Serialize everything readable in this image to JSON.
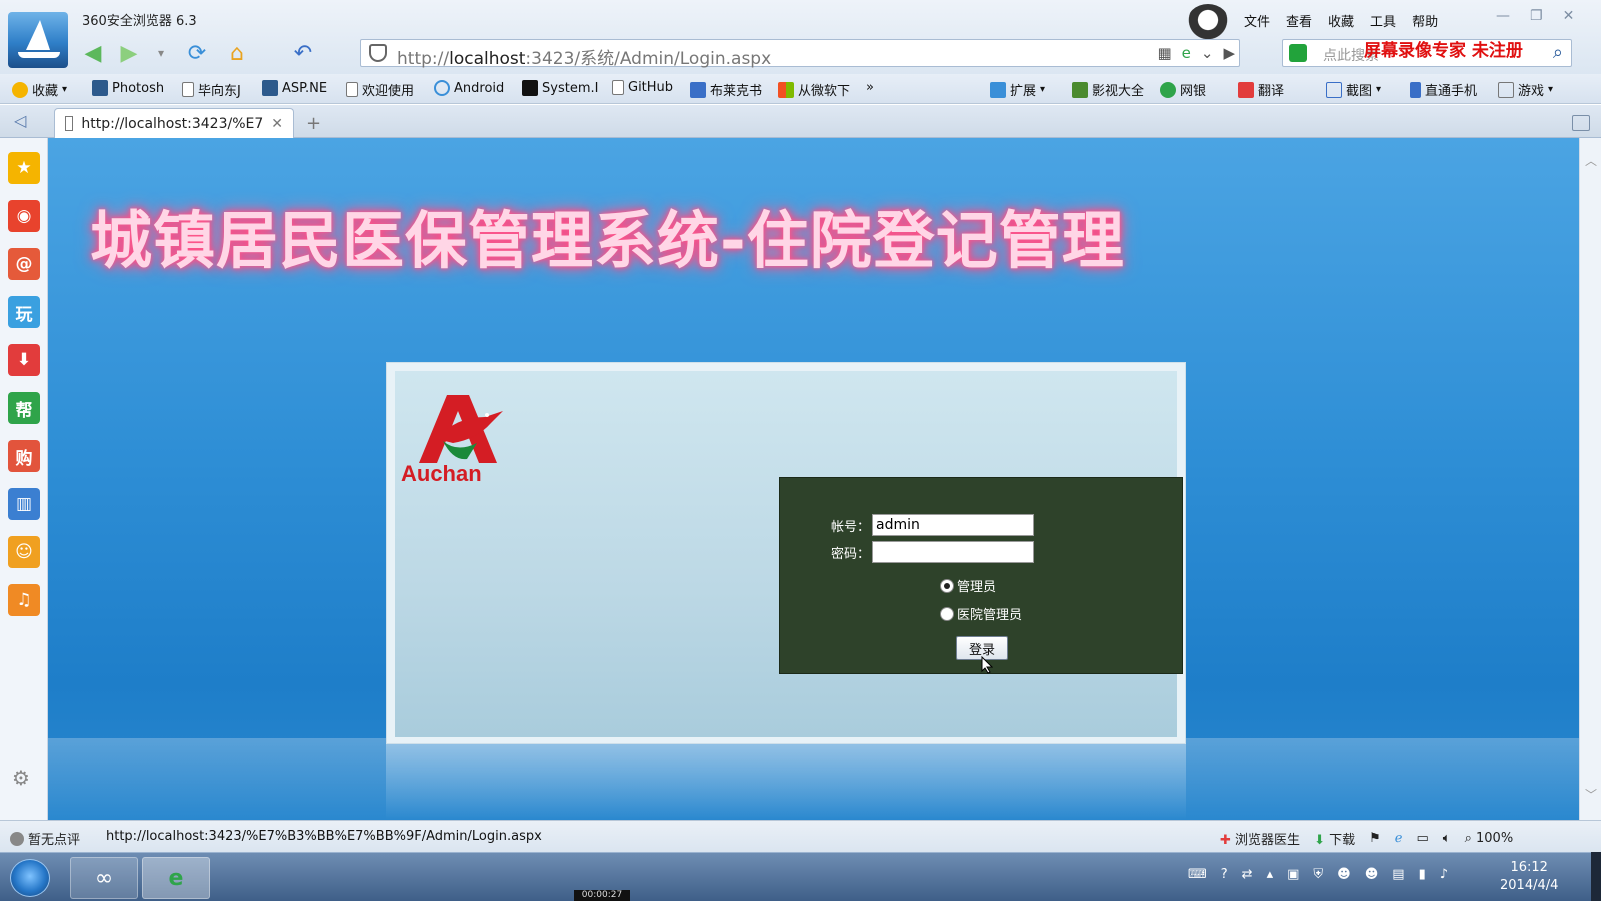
{
  "window": {
    "title": "360安全浏览器 6.3",
    "menu": [
      "文件",
      "查看",
      "收藏",
      "工具",
      "帮助"
    ],
    "watermark": "屏幕录像专家  未注册"
  },
  "nav": {
    "url_prefix": "http://",
    "url_host": "localhost",
    "url_rest": ":3423/系统/Admin/Login.aspx",
    "search_placeholder": "点此搜索"
  },
  "bookmarks": {
    "left": [
      {
        "label": "收藏",
        "icon": "star-icon"
      },
      {
        "label": "Photosh",
        "icon": "v-icon"
      },
      {
        "label": "毕向东J",
        "icon": "page-icon"
      },
      {
        "label": "ASP.NE",
        "icon": "v-icon"
      },
      {
        "label": "欢迎使用",
        "icon": "page-icon"
      },
      {
        "label": "Android",
        "icon": "play-icon"
      },
      {
        "label": "System.I",
        "icon": "m-icon"
      },
      {
        "label": "GitHub",
        "icon": "page-icon"
      },
      {
        "label": "布莱克书",
        "icon": "paw-icon"
      },
      {
        "label": "从微软下",
        "icon": "windows-icon"
      }
    ],
    "more": "»",
    "right": [
      {
        "label": "扩展",
        "icon": "puzzle-icon"
      },
      {
        "label": "影视大全",
        "icon": "video-icon"
      },
      {
        "label": "网银",
        "icon": "bank-icon"
      },
      {
        "label": "翻译",
        "icon": "translate-icon"
      },
      {
        "label": "截图",
        "icon": "screenshot-icon"
      },
      {
        "label": "直通手机",
        "icon": "phone-icon"
      },
      {
        "label": "游戏",
        "icon": "game-icon"
      }
    ]
  },
  "tab": {
    "title": "http://localhost:3423/%E7",
    "close": "✕",
    "new": "+"
  },
  "sidebar": {
    "items": [
      {
        "icon": "favorites-star-icon",
        "glyph": "★",
        "color": "#f5b400"
      },
      {
        "icon": "weibo-icon",
        "glyph": "◉",
        "color": "#e8432d"
      },
      {
        "icon": "mail-icon",
        "glyph": "@",
        "color": "#e55a3a"
      },
      {
        "icon": "play-icon",
        "glyph": "玩",
        "color": "#3aa0e0"
      },
      {
        "icon": "download-icon",
        "glyph": "⬇",
        "color": "#e23c3c"
      },
      {
        "icon": "help-icon",
        "glyph": "帮",
        "color": "#2fa44a"
      },
      {
        "icon": "shopping-icon",
        "glyph": "购",
        "color": "#e2543c"
      },
      {
        "icon": "reading-icon",
        "glyph": "▥",
        "color": "#3b7fd1"
      },
      {
        "icon": "joke-icon",
        "glyph": "☺",
        "color": "#f0a020"
      },
      {
        "icon": "music-icon",
        "glyph": "♫",
        "color": "#f08a24"
      }
    ]
  },
  "page": {
    "heading": "城镇居民医保管理系统-住院登记管理",
    "logo_text": "Auchan",
    "form": {
      "account_label": "帐号：",
      "account_value": "admin",
      "password_label": "密码：",
      "password_value": "",
      "role_options": [
        "管理员",
        "医院管理员"
      ],
      "selected_role": "管理员",
      "submit_label": "登录"
    }
  },
  "statusbar": {
    "rating": "暂无点评",
    "url": "http://localhost:3423/%E7%B3%BB%E7%BB%9F/Admin/Login.aspx",
    "doctor": "浏览器医生",
    "download": "下载",
    "zoom": "100%"
  },
  "taskbar": {
    "time": "16:12",
    "date": "2014/4/4",
    "recording_time": "00:00:27"
  },
  "colors": {
    "page_background": "#2f8fd6",
    "form_background": "#2e422a",
    "heading_glow": "#ff3b7a",
    "logo_red": "#d41d24",
    "watermark_red": "#e01010"
  }
}
